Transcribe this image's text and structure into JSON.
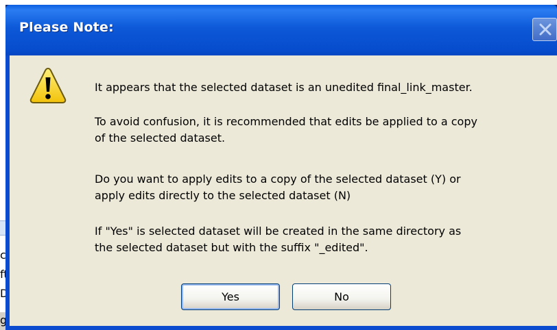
{
  "background_window": {
    "text_fragments": [
      "c",
      "ft",
      "De",
      "gl"
    ]
  },
  "dialog": {
    "title": "Please Note:",
    "close_icon": "close-icon",
    "warning_icon": "warning-icon",
    "messages": [
      "It appears that the selected dataset is an unedited final_link_master.",
      "To avoid confusion, it is recommended that edits be applied to a copy",
      "of the selected dataset.",
      "Do you want to apply edits to a copy of the selected dataset (Y) or",
      "apply edits directly to the selected dataset (N)",
      "If \"Yes\" is selected dataset will be created in the same directory as",
      "the selected dataset but with the suffix \"_edited\"."
    ],
    "buttons": {
      "yes_label": "Yes",
      "no_label": "No"
    }
  },
  "colors": {
    "title_bar": "#0a5ee0",
    "dialog_face": "#ece9d8",
    "warning_yellow": "#f6d21a"
  }
}
